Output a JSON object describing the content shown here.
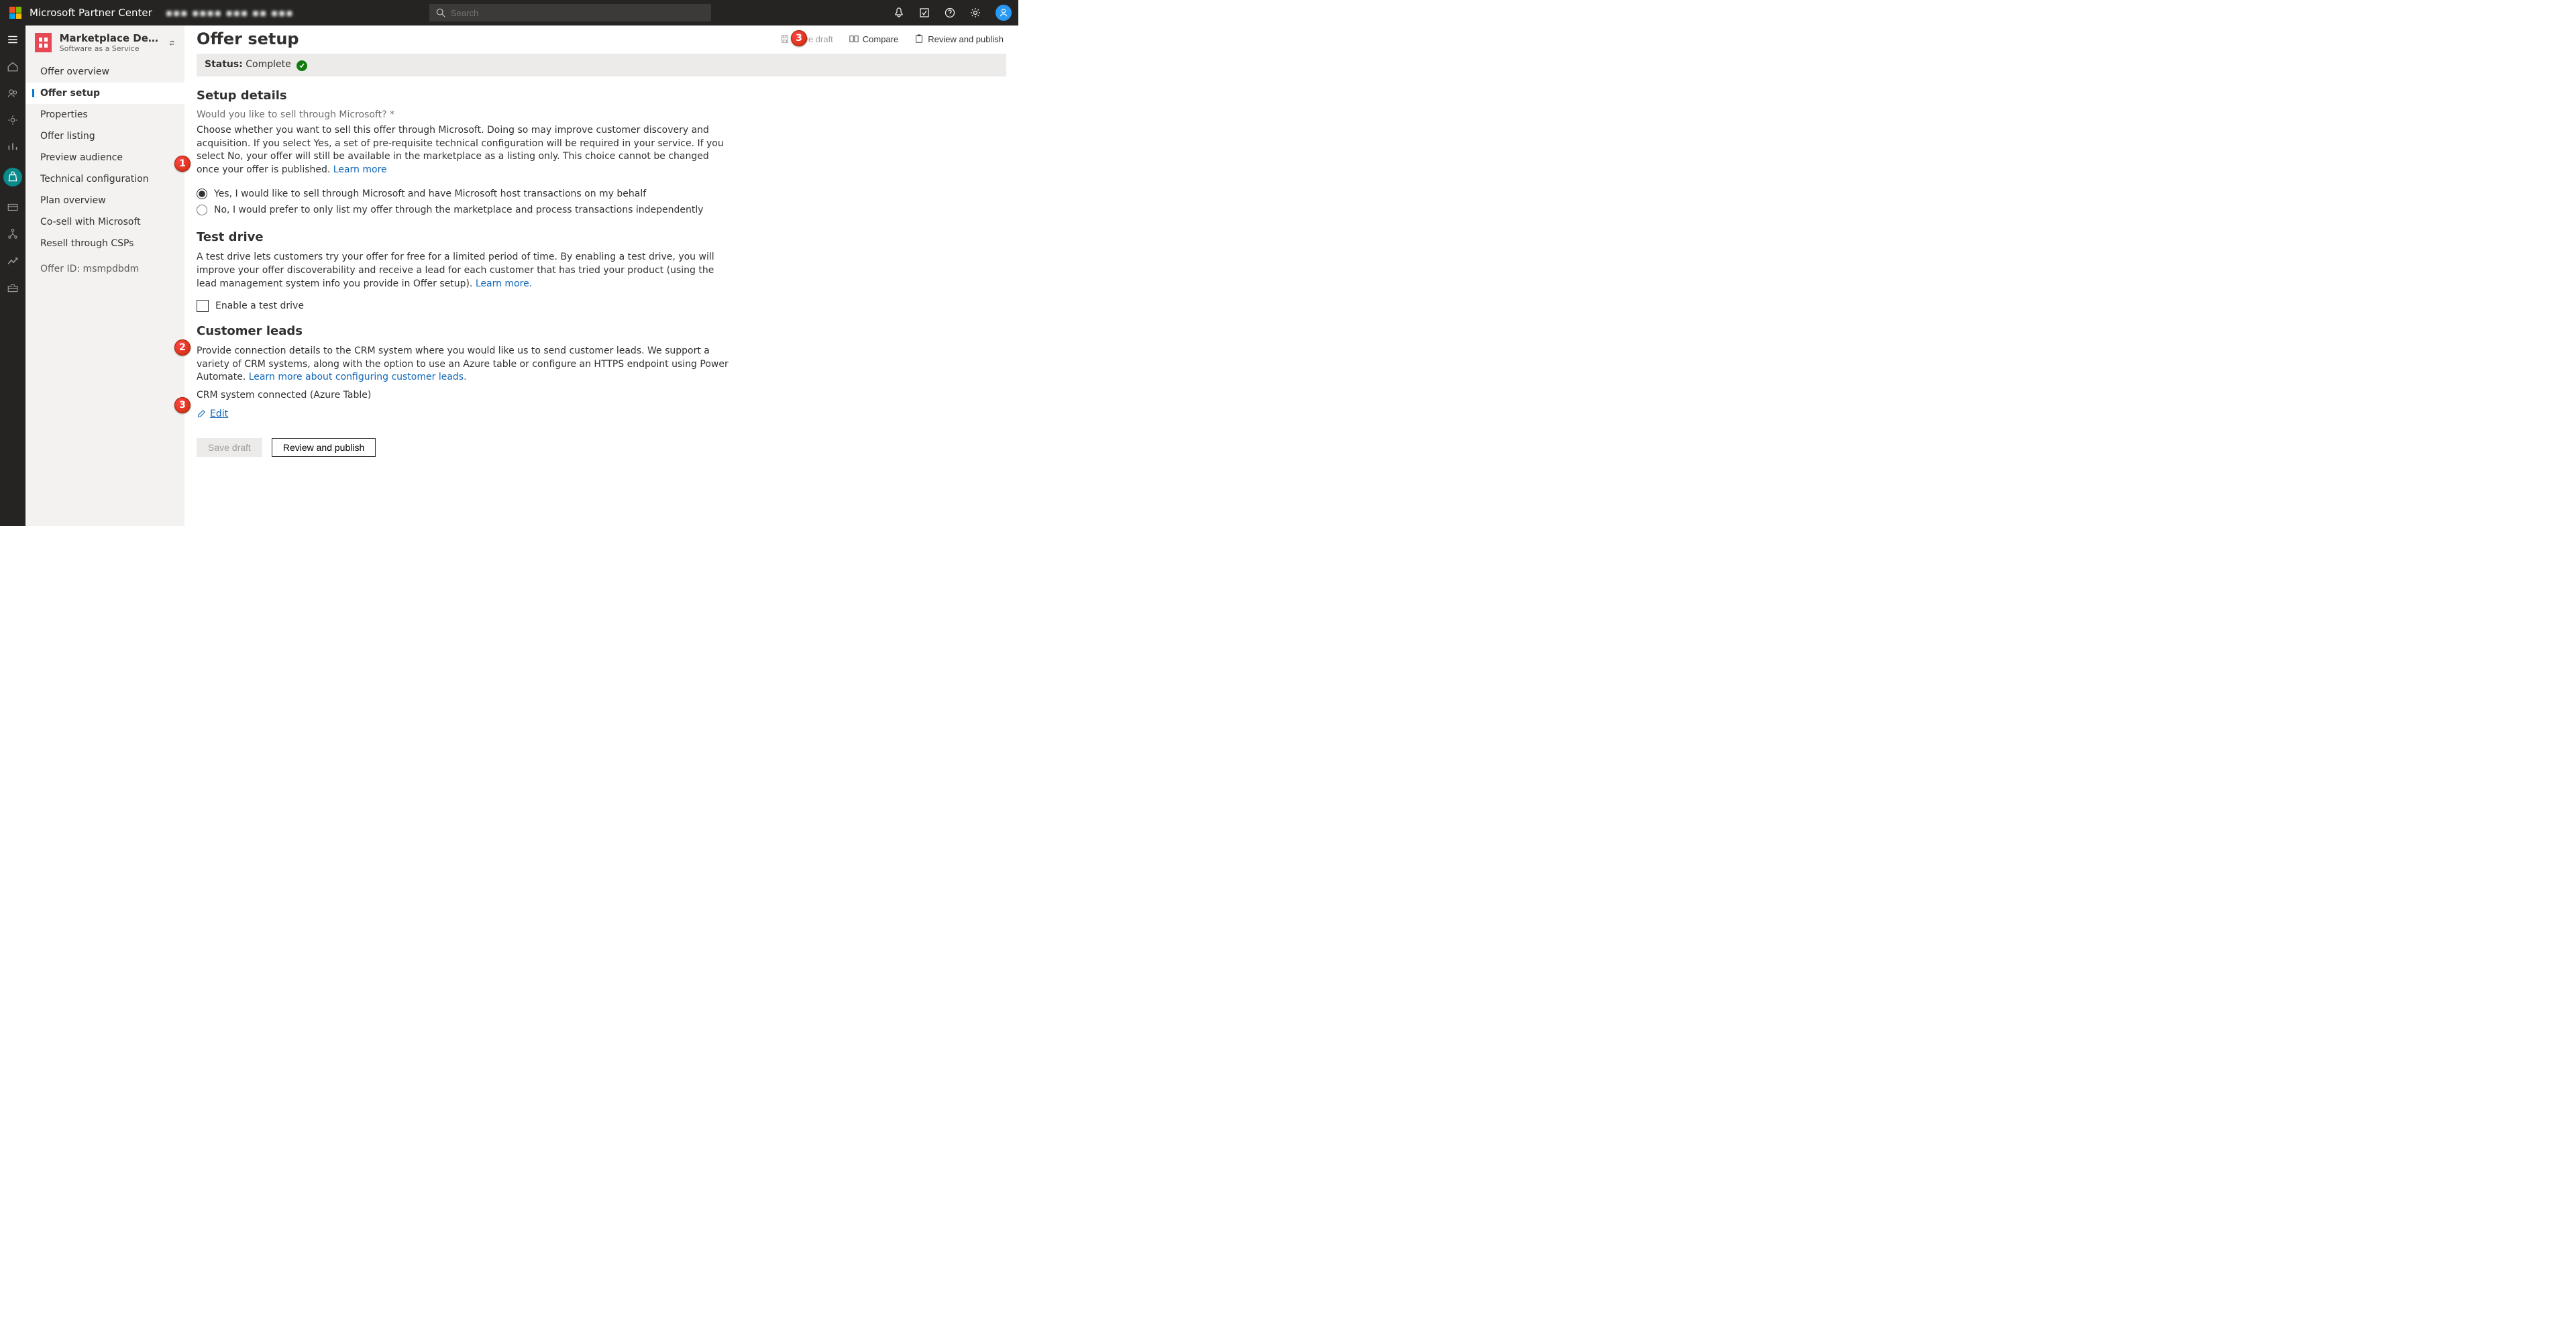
{
  "top": {
    "brand": "Microsoft Partner Center",
    "blurred": "▪▪▪ ▪▪▪▪ ▪▪▪  ▪▪ ▪▪▪",
    "search_placeholder": "Search"
  },
  "topicons": [
    "bell",
    "diagnostics",
    "help",
    "settings"
  ],
  "nav": {
    "title": "Marketplace Demo - …",
    "subtitle": "Software as a Service",
    "items": [
      {
        "label": "Offer overview"
      },
      {
        "label": "Offer setup",
        "active": true
      },
      {
        "label": "Properties"
      },
      {
        "label": "Offer listing"
      },
      {
        "label": "Preview audience"
      },
      {
        "label": "Technical configuration"
      },
      {
        "label": "Plan overview"
      },
      {
        "label": "Co-sell with Microsoft"
      },
      {
        "label": "Resell through CSPs"
      }
    ],
    "offer_id_label": "Offer ID: msmpdbdm"
  },
  "hdr": {
    "title": "Offer setup",
    "save_draft": "Save draft",
    "compare": "Compare",
    "review": "Review and publish"
  },
  "status": {
    "label": "Status:",
    "value": "Complete"
  },
  "setup": {
    "heading": "Setup details",
    "question": "Would you like to sell through Microsoft? *",
    "desc": "Choose whether you want to sell this offer through Microsoft. Doing so may improve customer discovery and acquisition. If you select Yes, a set of pre-requisite technical configuration will be required in your service. If you select No, your offer will still be available in the marketplace as a listing only. This choice cannot be changed once your offer is published. ",
    "learn": "Learn more",
    "opt_yes": "Yes, I would like to sell through Microsoft and have Microsoft host transactions on my behalf",
    "opt_no": "No, I would prefer to only list my offer through the marketplace and process transactions independently"
  },
  "testdrive": {
    "heading": "Test drive",
    "desc": "A test drive lets customers try your offer for free for a limited period of time. By enabling a test drive, you will improve your offer discoverability and receive a lead for each customer that has tried your product (using the lead management system info you provide in Offer setup). ",
    "learn": "Learn more.",
    "checkbox": "Enable a test drive"
  },
  "leads": {
    "heading": "Customer leads",
    "desc": "Provide connection details to the CRM system where you would like us to send customer leads. We support a variety of CRM systems, along with the option to use an Azure table or configure an HTTPS endpoint using Power Automate. ",
    "learn": "Learn more about configuring customer leads.",
    "connected": "CRM system connected (Azure Table)",
    "edit": "Edit"
  },
  "btns": {
    "save": "Save draft",
    "review": "Review and publish"
  },
  "badges": {
    "b1": "1",
    "b2": "2",
    "b3a": "3",
    "b3b": "3"
  }
}
